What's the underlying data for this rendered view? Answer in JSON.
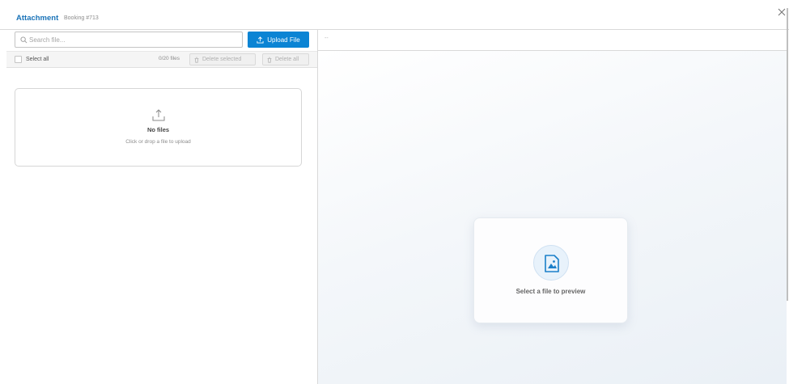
{
  "header": {
    "title": "Attachment",
    "subtitle": "Booking #713"
  },
  "left": {
    "search": {
      "placeholder": "Search file...",
      "value": ""
    },
    "upload_label": "Upload File",
    "toolbar": {
      "select_all_label": "Select all",
      "select_all_checked": false,
      "file_count": "0/20 files",
      "delete_selected_label": "Delete selected",
      "delete_all_label": "Delete all"
    },
    "dropzone": {
      "title": "No files",
      "subtitle": "Click or drop a file to upload"
    }
  },
  "right": {
    "selected_file_name": "--",
    "preview_placeholder": "Select a file to preview"
  },
  "colors": {
    "accent": "#0b84d4",
    "title": "#1a73b8"
  },
  "icons": [
    "search-icon",
    "upload-icon",
    "trash-icon",
    "close-icon",
    "image-file-icon"
  ]
}
